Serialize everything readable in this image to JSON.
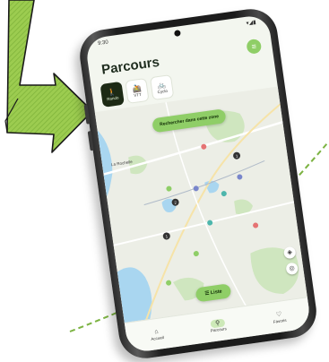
{
  "colors": {
    "accent": "#8fce67",
    "accent_dark": "#1d2a15",
    "arrow_green": "#8bc34a",
    "route_dash": "#7cb342"
  },
  "status_bar": {
    "time": "9:30",
    "icons": "▾◢▮"
  },
  "header": {
    "title": "Parcours",
    "filter_icon": "filter-icon"
  },
  "chips": [
    {
      "label": "Rando",
      "icon": "hiker-icon"
    },
    {
      "label": "VTT",
      "icon": "mountain-bike-icon"
    },
    {
      "label": "Cyclo",
      "icon": "bike-icon"
    }
  ],
  "map": {
    "search_zone_label": "Rechercher dans cette zone",
    "place_label": "La Rochelle",
    "list_label": "Liste"
  },
  "bottom_nav": [
    {
      "label": "Accueil",
      "icon": "home-icon"
    },
    {
      "label": "Parcours",
      "icon": "route-icon"
    },
    {
      "label": "Favoris",
      "icon": "heart-icon"
    }
  ]
}
